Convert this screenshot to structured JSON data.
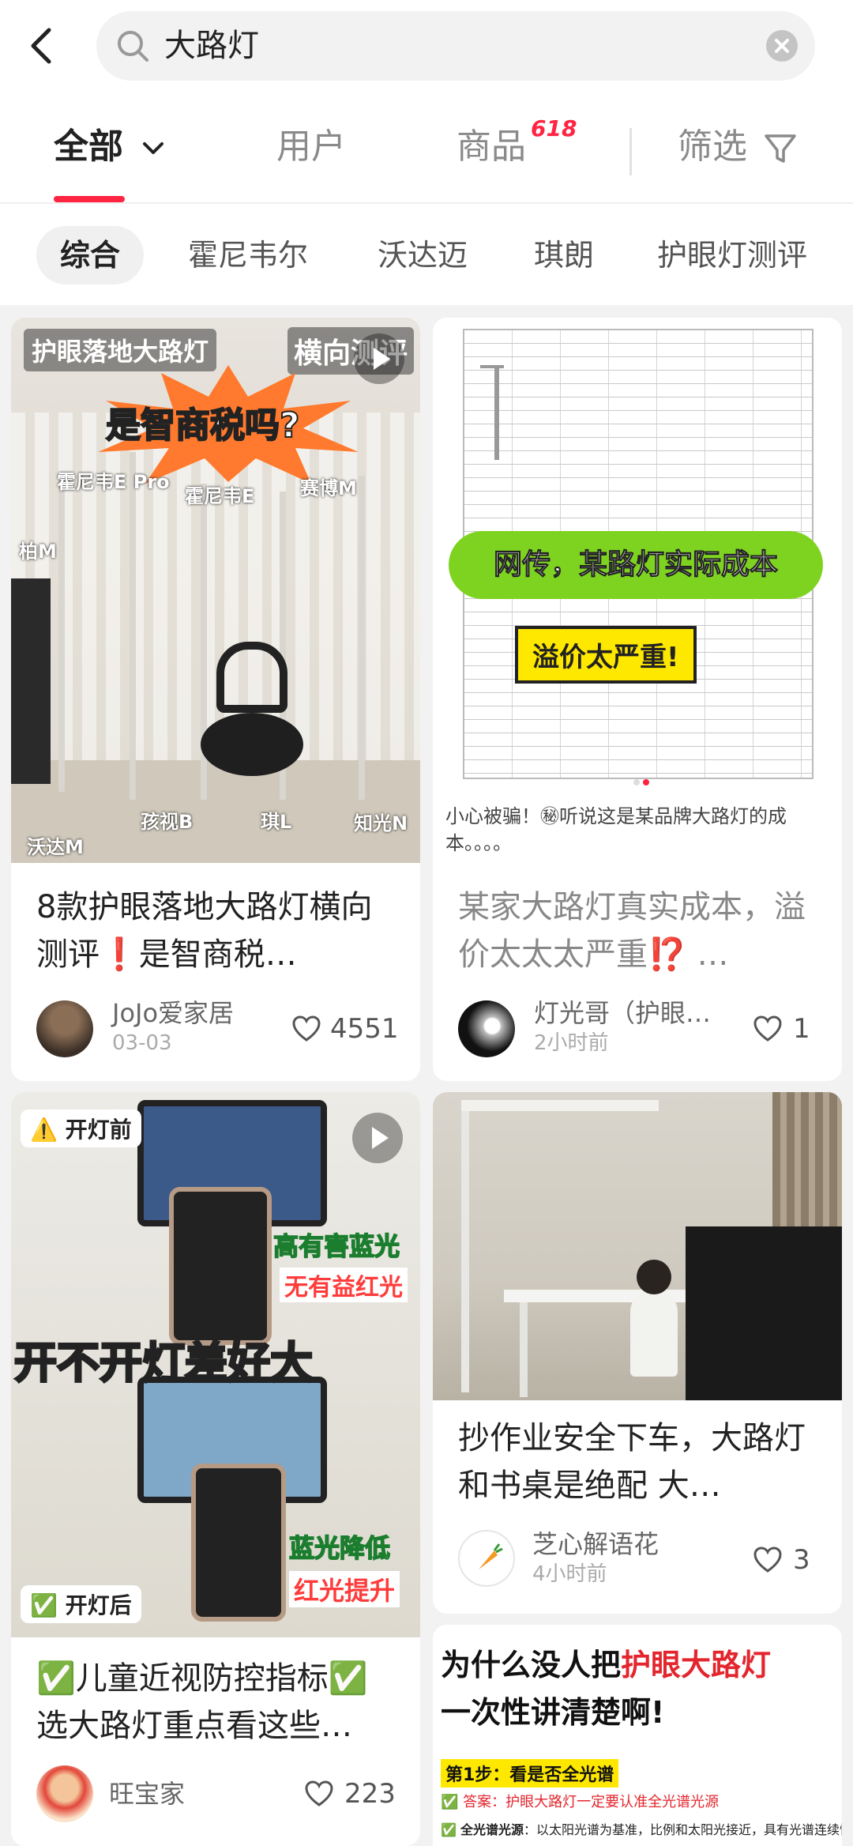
{
  "search": {
    "query": "大路灯"
  },
  "tabs": {
    "all": "全部",
    "users": "用户",
    "goods": "商品",
    "badge": "618",
    "filter": "筛选"
  },
  "chips": [
    "综合",
    "霍尼韦尔",
    "沃达迈",
    "琪朗",
    "护眼灯测评"
  ],
  "cards": [
    {
      "overlay": {
        "headline": "护眼落地大路灯",
        "headline2": "横向测评",
        "burst": "是智商税吗?",
        "labels": [
          "霍尼韦E Pro",
          "霍尼韦E",
          "赛博M",
          "柏M",
          "孩视B",
          "琪L",
          "知光N",
          "沃达M"
        ]
      },
      "title": "8款护眼落地大路灯横向测评❗️是智商税…",
      "author": "JoJo爱家居",
      "date": "03-03",
      "likes": "4551"
    },
    {
      "overlay": {
        "banner": "网传，某路灯实际成本",
        "tag": "溢价太严重!",
        "caption": "小心被骗！㊙听说这是某品牌大路灯的成本。。。。"
      },
      "title": "某家大路灯真实成本，溢价太太太严重⁉️ …",
      "author": "灯光哥（护眼…",
      "date": "2小时前",
      "likes": "1"
    },
    {
      "overlay": {
        "before": "开灯前",
        "line1": "高有害蓝光",
        "line2": "无有益红光",
        "center": "开不开灯差好大",
        "line3": "蓝光降低",
        "line4": "红光提升",
        "after": "开灯后"
      },
      "title": "✅儿童近视防控指标✅选大路灯重点看这些…",
      "author": "旺宝家",
      "likes": "223"
    },
    {
      "title": "抄作业安全下车，大路灯和书桌是绝配 大…",
      "author": "芝心解语花",
      "date": "4小时前",
      "likes": "3"
    },
    {
      "headline_a": "为什么没人把",
      "headline_b": "护眼大路灯",
      "headline_c": "一次性讲清楚啊!",
      "step": "第1步：看是否全光谱",
      "answer": "答案：护眼大路灯一定要认准全光谱光源",
      "note_label": "全光谱光源",
      "note": "：以太阳光谱为基准，比例和太阳光接近，具有光谱连续性"
    }
  ],
  "colors": {
    "accent": "#ff2442"
  }
}
